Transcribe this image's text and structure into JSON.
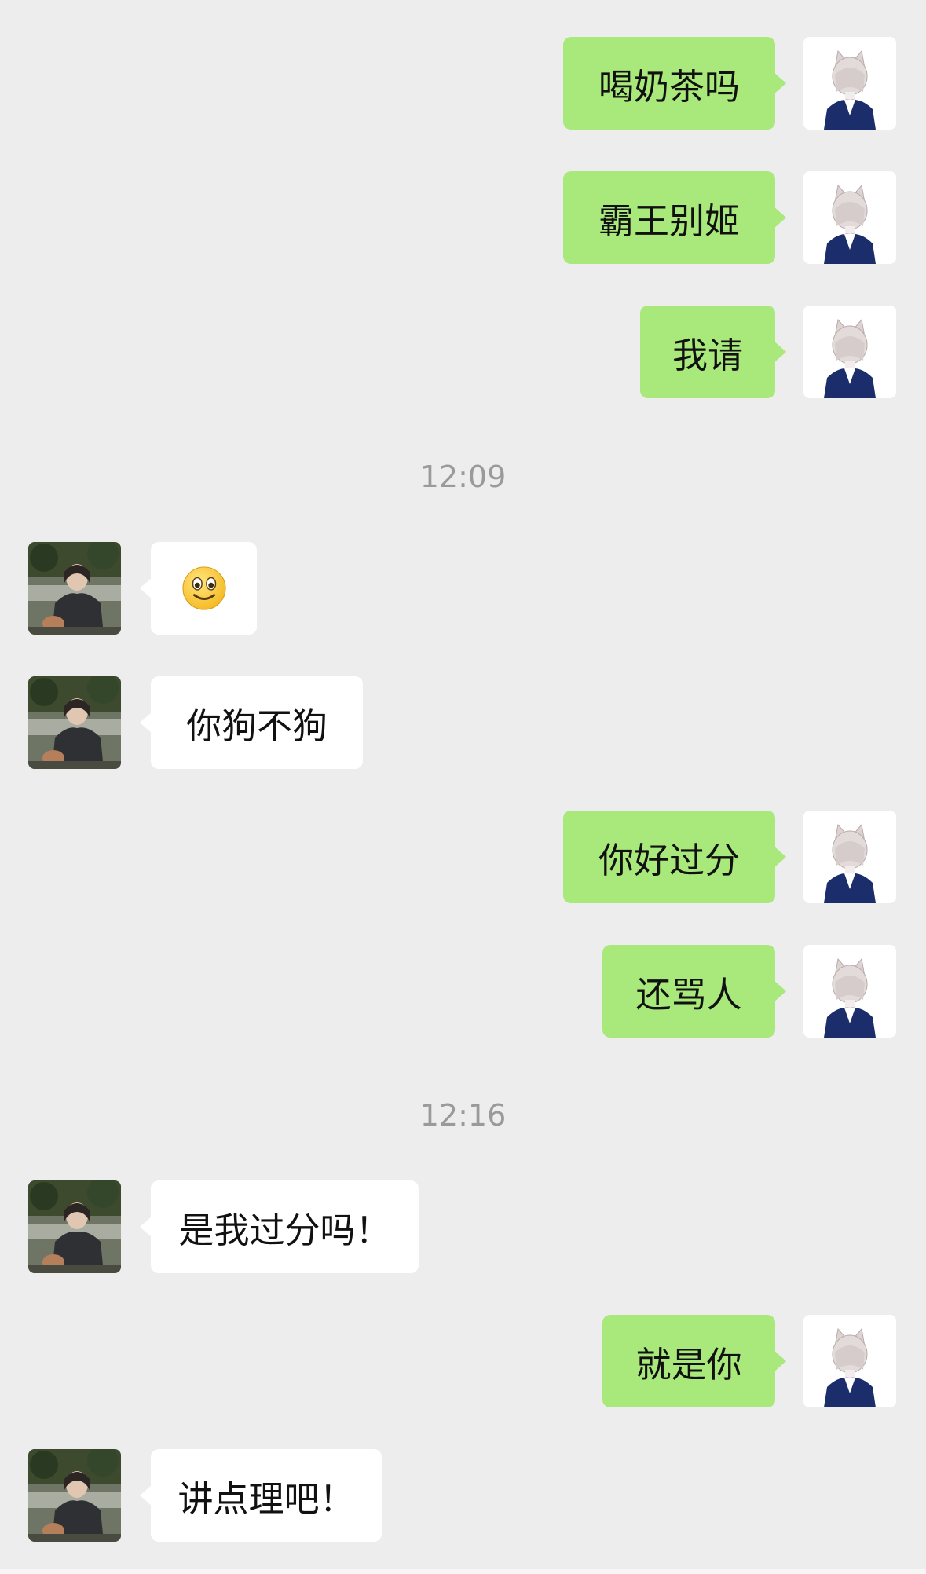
{
  "conversation": {
    "messages": [
      {
        "sender": "me",
        "text": "喝奶茶吗"
      },
      {
        "sender": "me",
        "text": "霸王别姬"
      },
      {
        "sender": "me",
        "text": "我请"
      },
      {
        "sender": "other",
        "text": "",
        "emoji": "smile-emoji"
      },
      {
        "sender": "other",
        "text": "你狗不狗"
      },
      {
        "sender": "me",
        "text": "你好过分"
      },
      {
        "sender": "me",
        "text": "还骂人"
      },
      {
        "sender": "other",
        "text": "是我过分吗！"
      },
      {
        "sender": "me",
        "text": "就是你"
      },
      {
        "sender": "other",
        "text": "讲点理吧！"
      }
    ],
    "timestamps": [
      "12:09",
      "12:16"
    ]
  },
  "colors": {
    "background": "#ededed",
    "my_bubble": "#a9e87a",
    "other_bubble": "#ffffff",
    "timestamp_text": "#9a9a9a"
  }
}
